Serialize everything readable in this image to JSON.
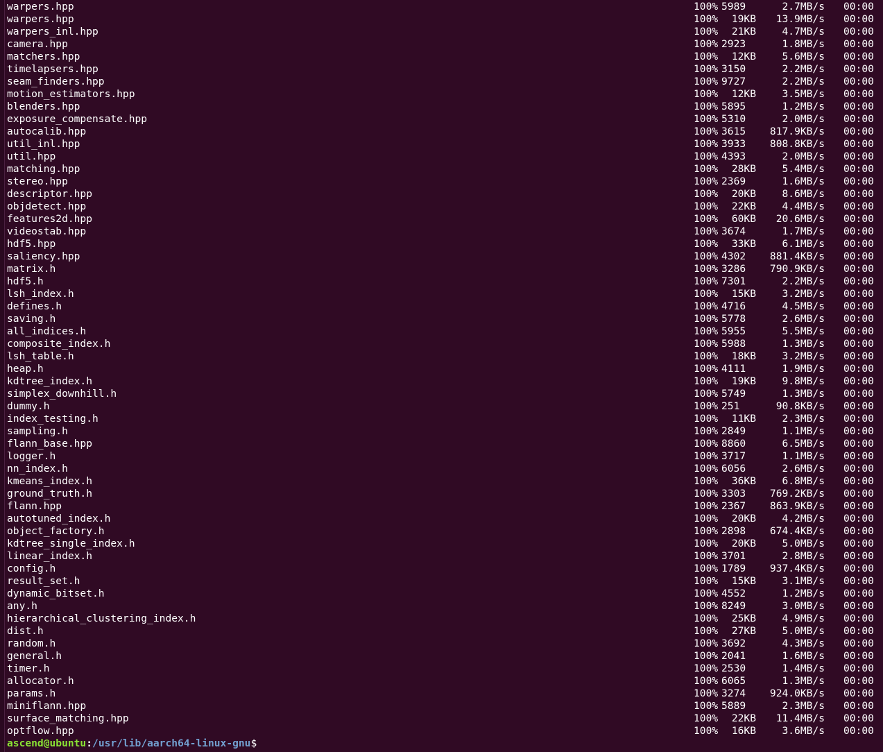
{
  "terminal": {
    "rows": [
      {
        "name": "warpers.hpp",
        "pct": "100%",
        "size": "5989",
        "speed": "2.7MB/s",
        "time": "00:00"
      },
      {
        "name": "warpers.hpp",
        "pct": "100%",
        "size": "19KB",
        "speed": "13.9MB/s",
        "time": "00:00"
      },
      {
        "name": "warpers_inl.hpp",
        "pct": "100%",
        "size": "21KB",
        "speed": "4.7MB/s",
        "time": "00:00"
      },
      {
        "name": "camera.hpp",
        "pct": "100%",
        "size": "2923",
        "speed": "1.8MB/s",
        "time": "00:00"
      },
      {
        "name": "matchers.hpp",
        "pct": "100%",
        "size": "12KB",
        "speed": "5.6MB/s",
        "time": "00:00"
      },
      {
        "name": "timelapsers.hpp",
        "pct": "100%",
        "size": "3150",
        "speed": "2.2MB/s",
        "time": "00:00"
      },
      {
        "name": "seam_finders.hpp",
        "pct": "100%",
        "size": "9727",
        "speed": "2.2MB/s",
        "time": "00:00"
      },
      {
        "name": "motion_estimators.hpp",
        "pct": "100%",
        "size": "12KB",
        "speed": "3.5MB/s",
        "time": "00:00"
      },
      {
        "name": "blenders.hpp",
        "pct": "100%",
        "size": "5895",
        "speed": "1.2MB/s",
        "time": "00:00"
      },
      {
        "name": "exposure_compensate.hpp",
        "pct": "100%",
        "size": "5310",
        "speed": "2.0MB/s",
        "time": "00:00"
      },
      {
        "name": "autocalib.hpp",
        "pct": "100%",
        "size": "3615",
        "speed": "817.9KB/s",
        "time": "00:00"
      },
      {
        "name": "util_inl.hpp",
        "pct": "100%",
        "size": "3933",
        "speed": "808.8KB/s",
        "time": "00:00"
      },
      {
        "name": "util.hpp",
        "pct": "100%",
        "size": "4393",
        "speed": "2.0MB/s",
        "time": "00:00"
      },
      {
        "name": "matching.hpp",
        "pct": "100%",
        "size": "28KB",
        "speed": "5.4MB/s",
        "time": "00:00"
      },
      {
        "name": "stereo.hpp",
        "pct": "100%",
        "size": "2369",
        "speed": "1.6MB/s",
        "time": "00:00"
      },
      {
        "name": "descriptor.hpp",
        "pct": "100%",
        "size": "20KB",
        "speed": "8.6MB/s",
        "time": "00:00"
      },
      {
        "name": "objdetect.hpp",
        "pct": "100%",
        "size": "22KB",
        "speed": "4.4MB/s",
        "time": "00:00"
      },
      {
        "name": "features2d.hpp",
        "pct": "100%",
        "size": "60KB",
        "speed": "20.6MB/s",
        "time": "00:00"
      },
      {
        "name": "videostab.hpp",
        "pct": "100%",
        "size": "3674",
        "speed": "1.7MB/s",
        "time": "00:00"
      },
      {
        "name": "hdf5.hpp",
        "pct": "100%",
        "size": "33KB",
        "speed": "6.1MB/s",
        "time": "00:00"
      },
      {
        "name": "saliency.hpp",
        "pct": "100%",
        "size": "4302",
        "speed": "881.4KB/s",
        "time": "00:00"
      },
      {
        "name": "matrix.h",
        "pct": "100%",
        "size": "3286",
        "speed": "790.9KB/s",
        "time": "00:00"
      },
      {
        "name": "hdf5.h",
        "pct": "100%",
        "size": "7301",
        "speed": "2.2MB/s",
        "time": "00:00"
      },
      {
        "name": "lsh_index.h",
        "pct": "100%",
        "size": "15KB",
        "speed": "3.2MB/s",
        "time": "00:00"
      },
      {
        "name": "defines.h",
        "pct": "100%",
        "size": "4716",
        "speed": "4.5MB/s",
        "time": "00:00"
      },
      {
        "name": "saving.h",
        "pct": "100%",
        "size": "5778",
        "speed": "2.6MB/s",
        "time": "00:00"
      },
      {
        "name": "all_indices.h",
        "pct": "100%",
        "size": "5955",
        "speed": "5.5MB/s",
        "time": "00:00"
      },
      {
        "name": "composite_index.h",
        "pct": "100%",
        "size": "5988",
        "speed": "1.3MB/s",
        "time": "00:00"
      },
      {
        "name": "lsh_table.h",
        "pct": "100%",
        "size": "18KB",
        "speed": "3.2MB/s",
        "time": "00:00"
      },
      {
        "name": "heap.h",
        "pct": "100%",
        "size": "4111",
        "speed": "1.9MB/s",
        "time": "00:00"
      },
      {
        "name": "kdtree_index.h",
        "pct": "100%",
        "size": "19KB",
        "speed": "9.8MB/s",
        "time": "00:00"
      },
      {
        "name": "simplex_downhill.h",
        "pct": "100%",
        "size": "5749",
        "speed": "1.3MB/s",
        "time": "00:00"
      },
      {
        "name": "dummy.h",
        "pct": "100%",
        "size": "251",
        "speed": "90.8KB/s",
        "time": "00:00"
      },
      {
        "name": "index_testing.h",
        "pct": "100%",
        "size": "11KB",
        "speed": "2.3MB/s",
        "time": "00:00"
      },
      {
        "name": "sampling.h",
        "pct": "100%",
        "size": "2849",
        "speed": "1.1MB/s",
        "time": "00:00"
      },
      {
        "name": "flann_base.hpp",
        "pct": "100%",
        "size": "8860",
        "speed": "6.5MB/s",
        "time": "00:00"
      },
      {
        "name": "logger.h",
        "pct": "100%",
        "size": "3717",
        "speed": "1.1MB/s",
        "time": "00:00"
      },
      {
        "name": "nn_index.h",
        "pct": "100%",
        "size": "6056",
        "speed": "2.6MB/s",
        "time": "00:00"
      },
      {
        "name": "kmeans_index.h",
        "pct": "100%",
        "size": "36KB",
        "speed": "6.8MB/s",
        "time": "00:00"
      },
      {
        "name": "ground_truth.h",
        "pct": "100%",
        "size": "3303",
        "speed": "769.2KB/s",
        "time": "00:00"
      },
      {
        "name": "flann.hpp",
        "pct": "100%",
        "size": "2367",
        "speed": "863.9KB/s",
        "time": "00:00"
      },
      {
        "name": "autotuned_index.h",
        "pct": "100%",
        "size": "20KB",
        "speed": "4.2MB/s",
        "time": "00:00"
      },
      {
        "name": "object_factory.h",
        "pct": "100%",
        "size": "2898",
        "speed": "674.4KB/s",
        "time": "00:00"
      },
      {
        "name": "kdtree_single_index.h",
        "pct": "100%",
        "size": "20KB",
        "speed": "5.0MB/s",
        "time": "00:00"
      },
      {
        "name": "linear_index.h",
        "pct": "100%",
        "size": "3701",
        "speed": "2.8MB/s",
        "time": "00:00"
      },
      {
        "name": "config.h",
        "pct": "100%",
        "size": "1789",
        "speed": "937.4KB/s",
        "time": "00:00"
      },
      {
        "name": "result_set.h",
        "pct": "100%",
        "size": "15KB",
        "speed": "3.1MB/s",
        "time": "00:00"
      },
      {
        "name": "dynamic_bitset.h",
        "pct": "100%",
        "size": "4552",
        "speed": "1.2MB/s",
        "time": "00:00"
      },
      {
        "name": "any.h",
        "pct": "100%",
        "size": "8249",
        "speed": "3.0MB/s",
        "time": "00:00"
      },
      {
        "name": "hierarchical_clustering_index.h",
        "pct": "100%",
        "size": "25KB",
        "speed": "4.9MB/s",
        "time": "00:00"
      },
      {
        "name": "dist.h",
        "pct": "100%",
        "size": "27KB",
        "speed": "5.0MB/s",
        "time": "00:00"
      },
      {
        "name": "random.h",
        "pct": "100%",
        "size": "3692",
        "speed": "4.3MB/s",
        "time": "00:00"
      },
      {
        "name": "general.h",
        "pct": "100%",
        "size": "2041",
        "speed": "1.6MB/s",
        "time": "00:00"
      },
      {
        "name": "timer.h",
        "pct": "100%",
        "size": "2530",
        "speed": "1.4MB/s",
        "time": "00:00"
      },
      {
        "name": "allocator.h",
        "pct": "100%",
        "size": "6065",
        "speed": "1.3MB/s",
        "time": "00:00"
      },
      {
        "name": "params.h",
        "pct": "100%",
        "size": "3274",
        "speed": "924.0KB/s",
        "time": "00:00"
      },
      {
        "name": "miniflann.hpp",
        "pct": "100%",
        "size": "5889",
        "speed": "2.3MB/s",
        "time": "00:00"
      },
      {
        "name": "surface_matching.hpp",
        "pct": "100%",
        "size": "22KB",
        "speed": "11.4MB/s",
        "time": "00:00"
      },
      {
        "name": "optflow.hpp",
        "pct": "100%",
        "size": "16KB",
        "speed": "3.6MB/s",
        "time": "00:00"
      }
    ],
    "prompt": {
      "user_host": "ascend@ubuntu",
      "separator": ":",
      "path": "/usr/lib/aarch64-linux-gnu",
      "symbol": "$"
    },
    "colors": {
      "background": "#300a24",
      "text": "#ffffff",
      "prompt_user": "#8ae234",
      "prompt_path": "#729fcf"
    }
  }
}
